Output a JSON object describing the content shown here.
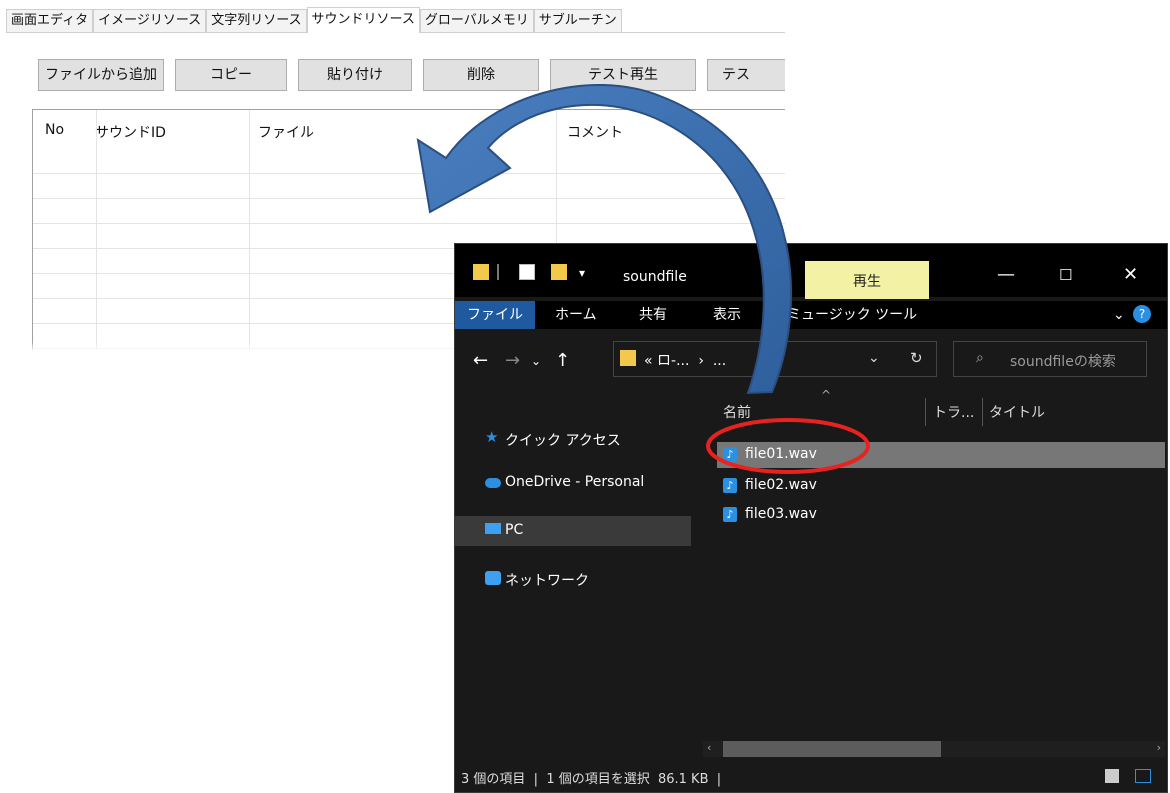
{
  "editor": {
    "tabs": [
      "画面エディタ",
      "イメージリソース",
      "文字列リソース",
      "サウンドリソース",
      "グローバルメモリ",
      "サブルーチン"
    ],
    "active_tab": "サウンドリソース",
    "buttons": [
      "ファイルから追加",
      "コピー",
      "貼り付け",
      "削除",
      "テスト再生",
      "テス"
    ],
    "columns": [
      "No",
      "サウンドID",
      "ファイル",
      "コメント"
    ]
  },
  "explorer": {
    "title": "soundfile",
    "context_tab": "再生",
    "ribbon_tabs": [
      "ファイル",
      "ホーム",
      "共有",
      "表示",
      "ミュージック ツール"
    ],
    "address": "« ロ-...  ›  ...",
    "search_placeholder": "soundfileの検索",
    "nav_items": [
      "クイック アクセス",
      "OneDrive - Personal",
      "PC",
      "ネットワーク"
    ],
    "selected_nav": "PC",
    "columns": [
      "名前",
      "トラ...",
      "タイトル"
    ],
    "files": [
      "file01.wav",
      "file02.wav",
      "file03.wav"
    ],
    "selected_file": "file01.wav",
    "status": "3 個の項目  |  1 個の項目を選択  86.1 KB  |"
  },
  "colors": {
    "arrow": "#3f72b3",
    "highlight_circle": "#e8231f",
    "context_tab_bg": "#f3f2a4"
  }
}
